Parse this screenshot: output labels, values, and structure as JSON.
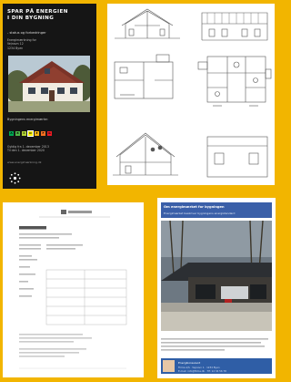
{
  "cover": {
    "title_line1": "SPAR PÅ ENERGIEN",
    "title_line2": "I DIN BYGNING",
    "subtitle": "- status og forbedringer",
    "info_line1": "Energimærkning for",
    "info_line2": "Vejnavn 12",
    "info_line3": "1234 Byen",
    "rating_label": "Bygningens energimærke:",
    "scale": [
      "A",
      "B",
      "C",
      "D",
      "E",
      "F",
      "G"
    ],
    "scale_colors": [
      "#00a651",
      "#50b848",
      "#b2d235",
      "#fff200",
      "#fdb913",
      "#f37021",
      "#ed1c24"
    ],
    "current_rating": "D",
    "dates_line1": "Gyldig fra 1. december 2013",
    "dates_line2": "Til den 1. december 2020",
    "website": "www.energimærkning.dk"
  },
  "drawings": {
    "panels": [
      "section-view-top",
      "elevation-view-top",
      "floor-plan-left",
      "floor-plan-right",
      "section-view-bottom",
      "elevation-view-bottom"
    ]
  },
  "label_doc": {
    "heading": "Energimærke",
    "logo_text": "ENERGISTYRELSEN"
  },
  "photo_page": {
    "heading": "Om energimærket for bygningen",
    "subheading": "Energimærket beskriver bygningens energistandard",
    "contact_line1": "Energikonsulent",
    "contact_line2": "Firma A/S · Vejnavn 1 · 1234 Byen",
    "contact_line3": "E-mail: info@firma.dk · Tlf: 12 34 56 78"
  },
  "colors": {
    "background": "#f2b500",
    "cover": "#151515",
    "accent_blue": "#3a5fa8"
  }
}
